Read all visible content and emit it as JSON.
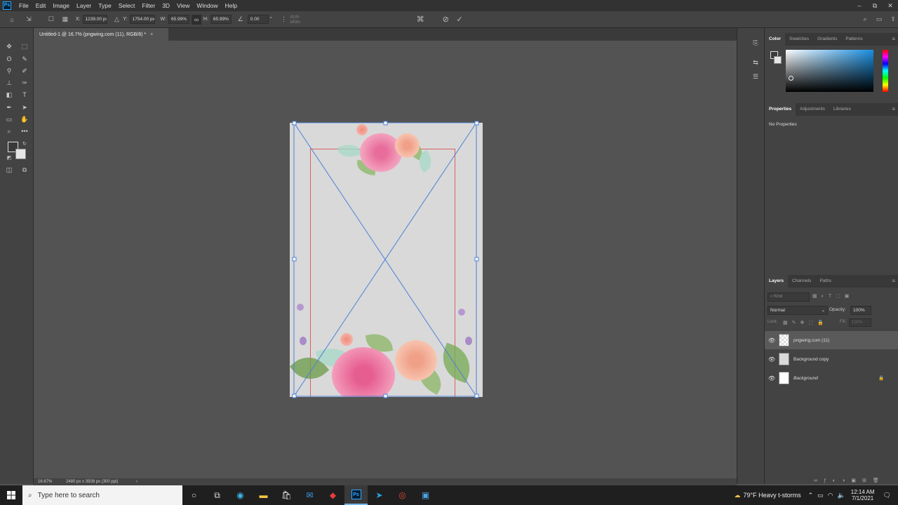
{
  "menubar": {
    "logo": "Ps",
    "items": [
      "File",
      "Edit",
      "Image",
      "Layer",
      "Type",
      "Select",
      "Filter",
      "3D",
      "View",
      "Window",
      "Help"
    ],
    "controls": [
      "–",
      "⧉",
      "✕"
    ]
  },
  "options": {
    "x_label": "X:",
    "x_value": "1239.00 px",
    "y_label": "Y:",
    "y_value": "1754.00 px",
    "w_label": "W:",
    "w_value": "65.99%",
    "h_label": "H:",
    "h_value": "65.99%",
    "angle_value": "0.00",
    "degree": "°",
    "antialias": "Anti-alias"
  },
  "document": {
    "tab_title": "Untitled-1 @ 16.7% (pngwing.com (11), RGB/8) *",
    "close": "×"
  },
  "status": {
    "zoom": "16.67%",
    "info": "2480 px x 3508 px (300 ppi)",
    "arrow": "›"
  },
  "color_panel": {
    "tabs": [
      "Color",
      "Swatches",
      "Gradients",
      "Patterns"
    ]
  },
  "properties_panel": {
    "tabs": [
      "Properties",
      "Adjustments",
      "Libraries"
    ],
    "content": "No Properties"
  },
  "layers_panel": {
    "tabs": [
      "Layers",
      "Channels",
      "Paths"
    ],
    "kind_placeholder": "Kind",
    "blend_mode": "Normal",
    "opacity_label": "Opacity:",
    "opacity_value": "100%",
    "lock_label": "Lock:",
    "fill_label": "Fill:",
    "fill_value": "100%",
    "layers": [
      {
        "name": "pngwing.com (11)"
      },
      {
        "name": "Background copy"
      },
      {
        "name": "Background"
      }
    ]
  },
  "taskbar": {
    "search_placeholder": "Type here to search",
    "weather": "79°F  Heavy t-storms",
    "time": "12:14 AM",
    "date": "7/1/2021"
  }
}
